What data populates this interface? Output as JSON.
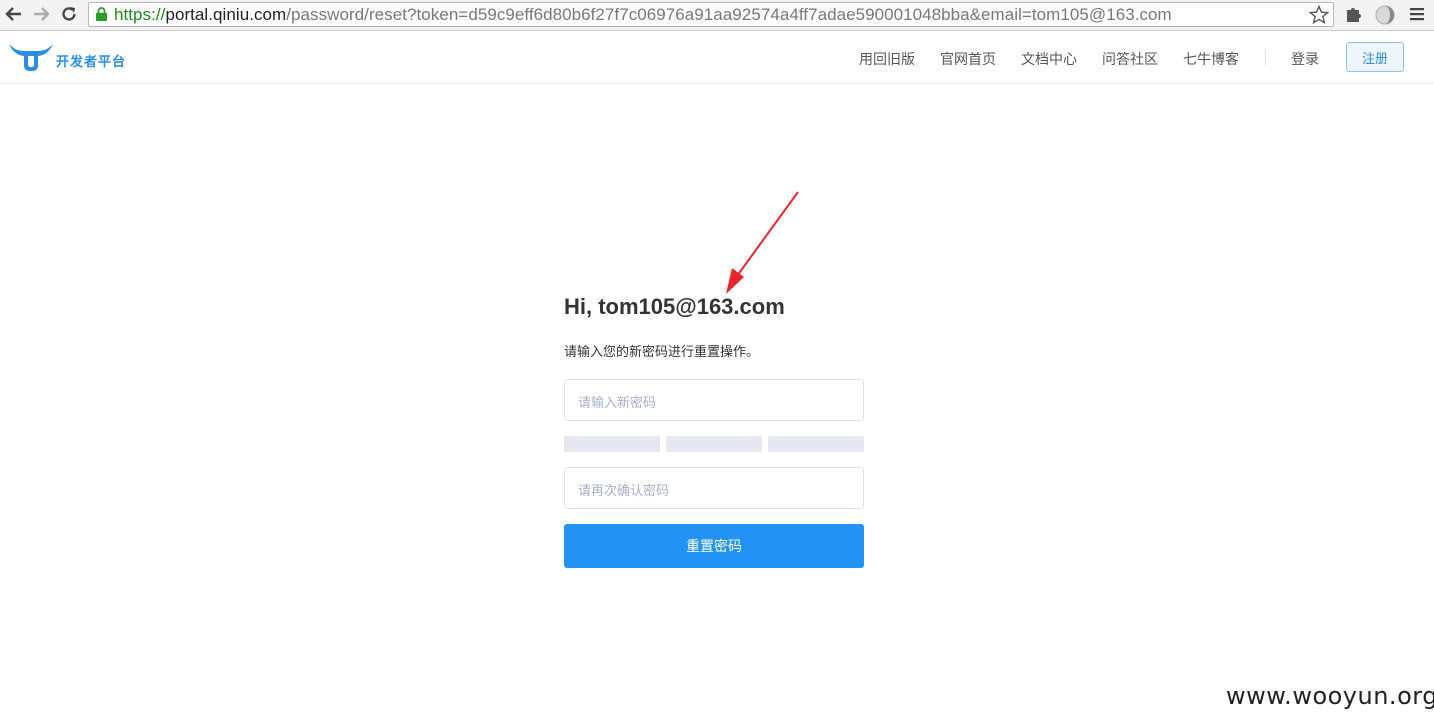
{
  "browser": {
    "url_scheme": "https://",
    "url_host": "portal.qiniu.com",
    "url_rest": "/password/reset?token=d59c9eff6d80b6f27f7c06976a91aa92574a4ff7adae590001048bba&email=tom105@163.com",
    "icons": [
      "back-icon",
      "forward-icon",
      "reload-icon",
      "lock-icon",
      "bookmark-star-icon",
      "extension-puzzle-icon",
      "extension-circle-icon",
      "menu-icon"
    ]
  },
  "header": {
    "brand": "开发者平台",
    "nav": [
      "用回旧版",
      "官网首页",
      "文档中心",
      "问答社区",
      "七牛博客"
    ],
    "login": "登录",
    "register": "注册"
  },
  "form": {
    "greeting": "Hi, tom105@163.com",
    "instruction": "请输入您的新密码进行重置操作。",
    "new_password_placeholder": "请输入新密码",
    "confirm_password_placeholder": "请再次确认密码",
    "submit": "重置密码"
  },
  "watermark": "www.wooyun.org",
  "colors": {
    "accent": "#2293f3",
    "brand": "#2a8ee6",
    "annotation_arrow": "#e8262b",
    "secure_url": "#1a8a1a"
  }
}
